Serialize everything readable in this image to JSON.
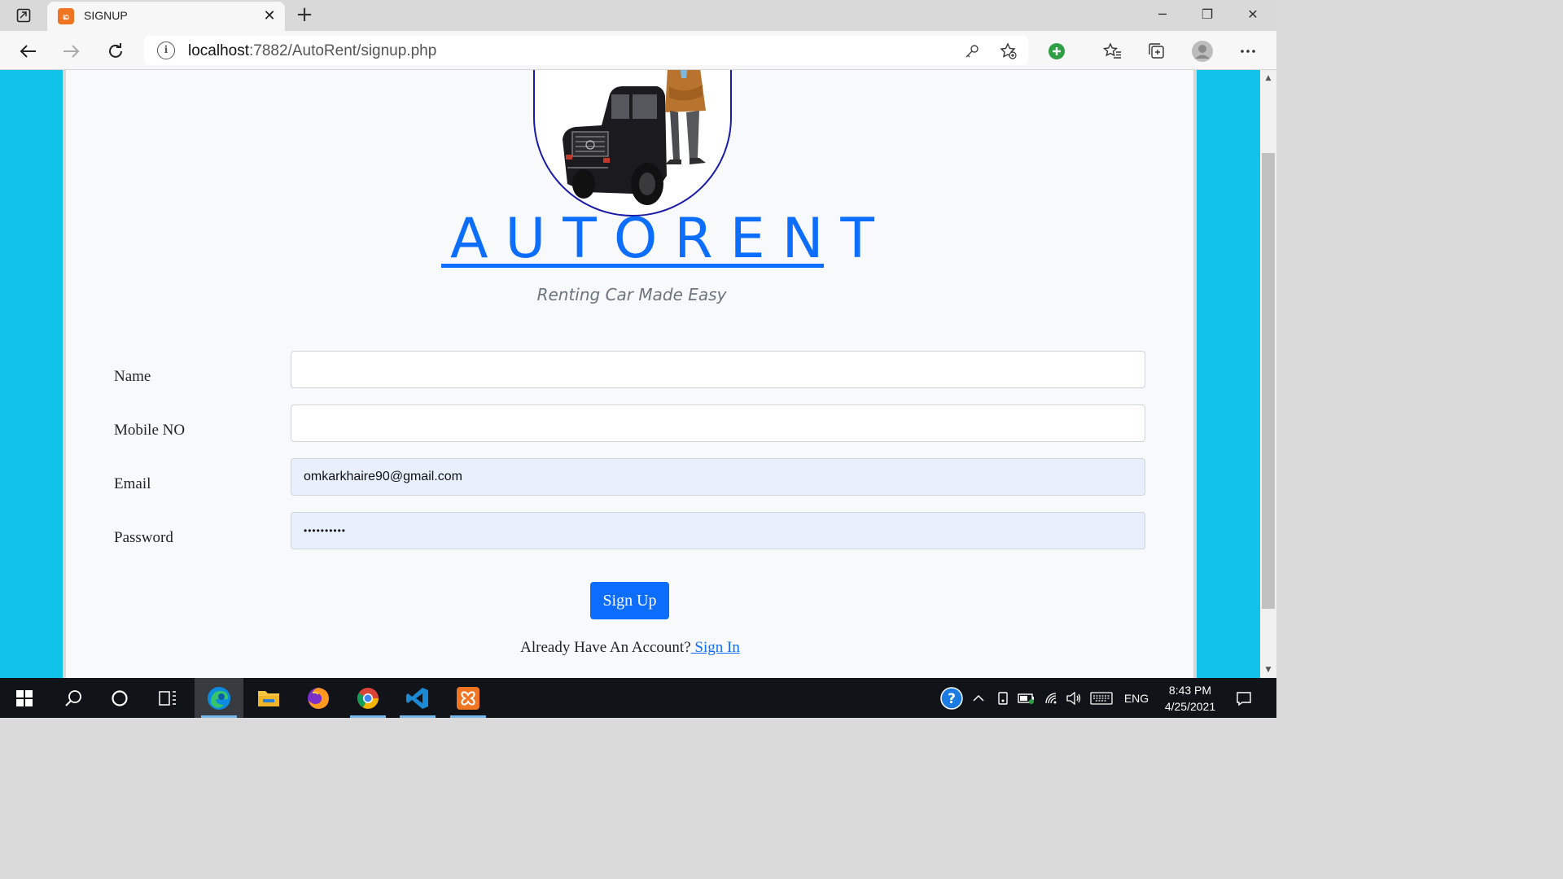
{
  "browser": {
    "tab_title": "SIGNUP",
    "url_host": "localhost",
    "url_path": ":7882/AutoRent/signup.php"
  },
  "page": {
    "brand": "AUTORENT",
    "tagline": "Renting Car Made Easy",
    "form": {
      "name_label": "Name",
      "name_value": "",
      "mobile_label": "Mobile NO",
      "mobile_value": "",
      "email_label": "Email",
      "email_value": "omkarkhaire90@gmail.com",
      "password_label": "Password",
      "password_value": "••••••••••"
    },
    "signup_button": "Sign Up",
    "have_account_text": "Already Have An Account?",
    "signin_link": " Sign In"
  },
  "taskbar": {
    "language": "ENG",
    "time": "8:43 PM",
    "date": "4/25/2021"
  },
  "colors": {
    "page_background": "#11c3e8",
    "brand_blue": "#0d6efd",
    "autofill_background": "#e8f0fe",
    "logo_border": "#1a1aa8"
  }
}
